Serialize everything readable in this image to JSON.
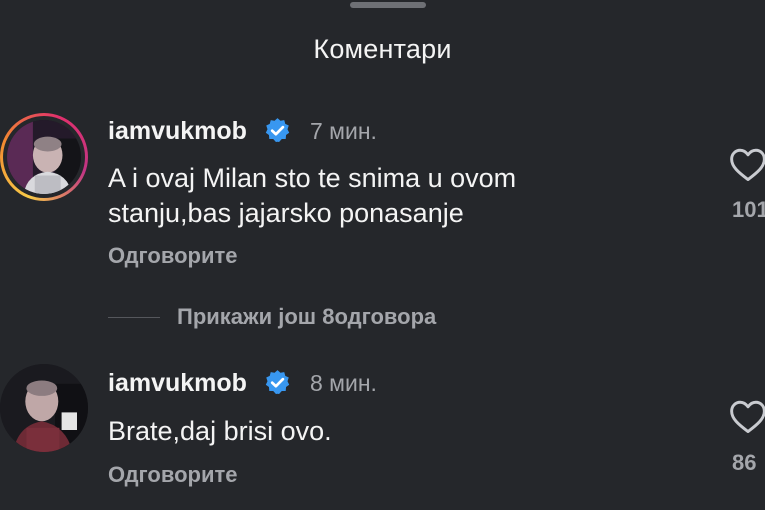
{
  "header": {
    "title": "Коментари"
  },
  "comments": [
    {
      "username": "iamvukmob",
      "time": "7 мин.",
      "text_line1": "A i ovaj Milan sto te snima u ovom",
      "text_line2": "stanju,bas jajarsko ponasanje",
      "reply_label": "Одговорите",
      "likes": "101",
      "has_story_ring": true
    },
    {
      "username": "iamvukmob",
      "time": "8 мин.",
      "text_line1": "Brate,daj brisi ovo.",
      "text_line2": "",
      "reply_label": "Одговорите",
      "likes": "86",
      "has_story_ring": false
    }
  ],
  "thread": {
    "view_more_label": "Прикажи још 8одговора"
  },
  "colors": {
    "background": "#25272b",
    "verified_badge": "#3897f0",
    "secondary_text": "#a4a6ab"
  },
  "icons": {
    "verified": "verified-badge-icon",
    "like": "heart-outline-icon"
  }
}
